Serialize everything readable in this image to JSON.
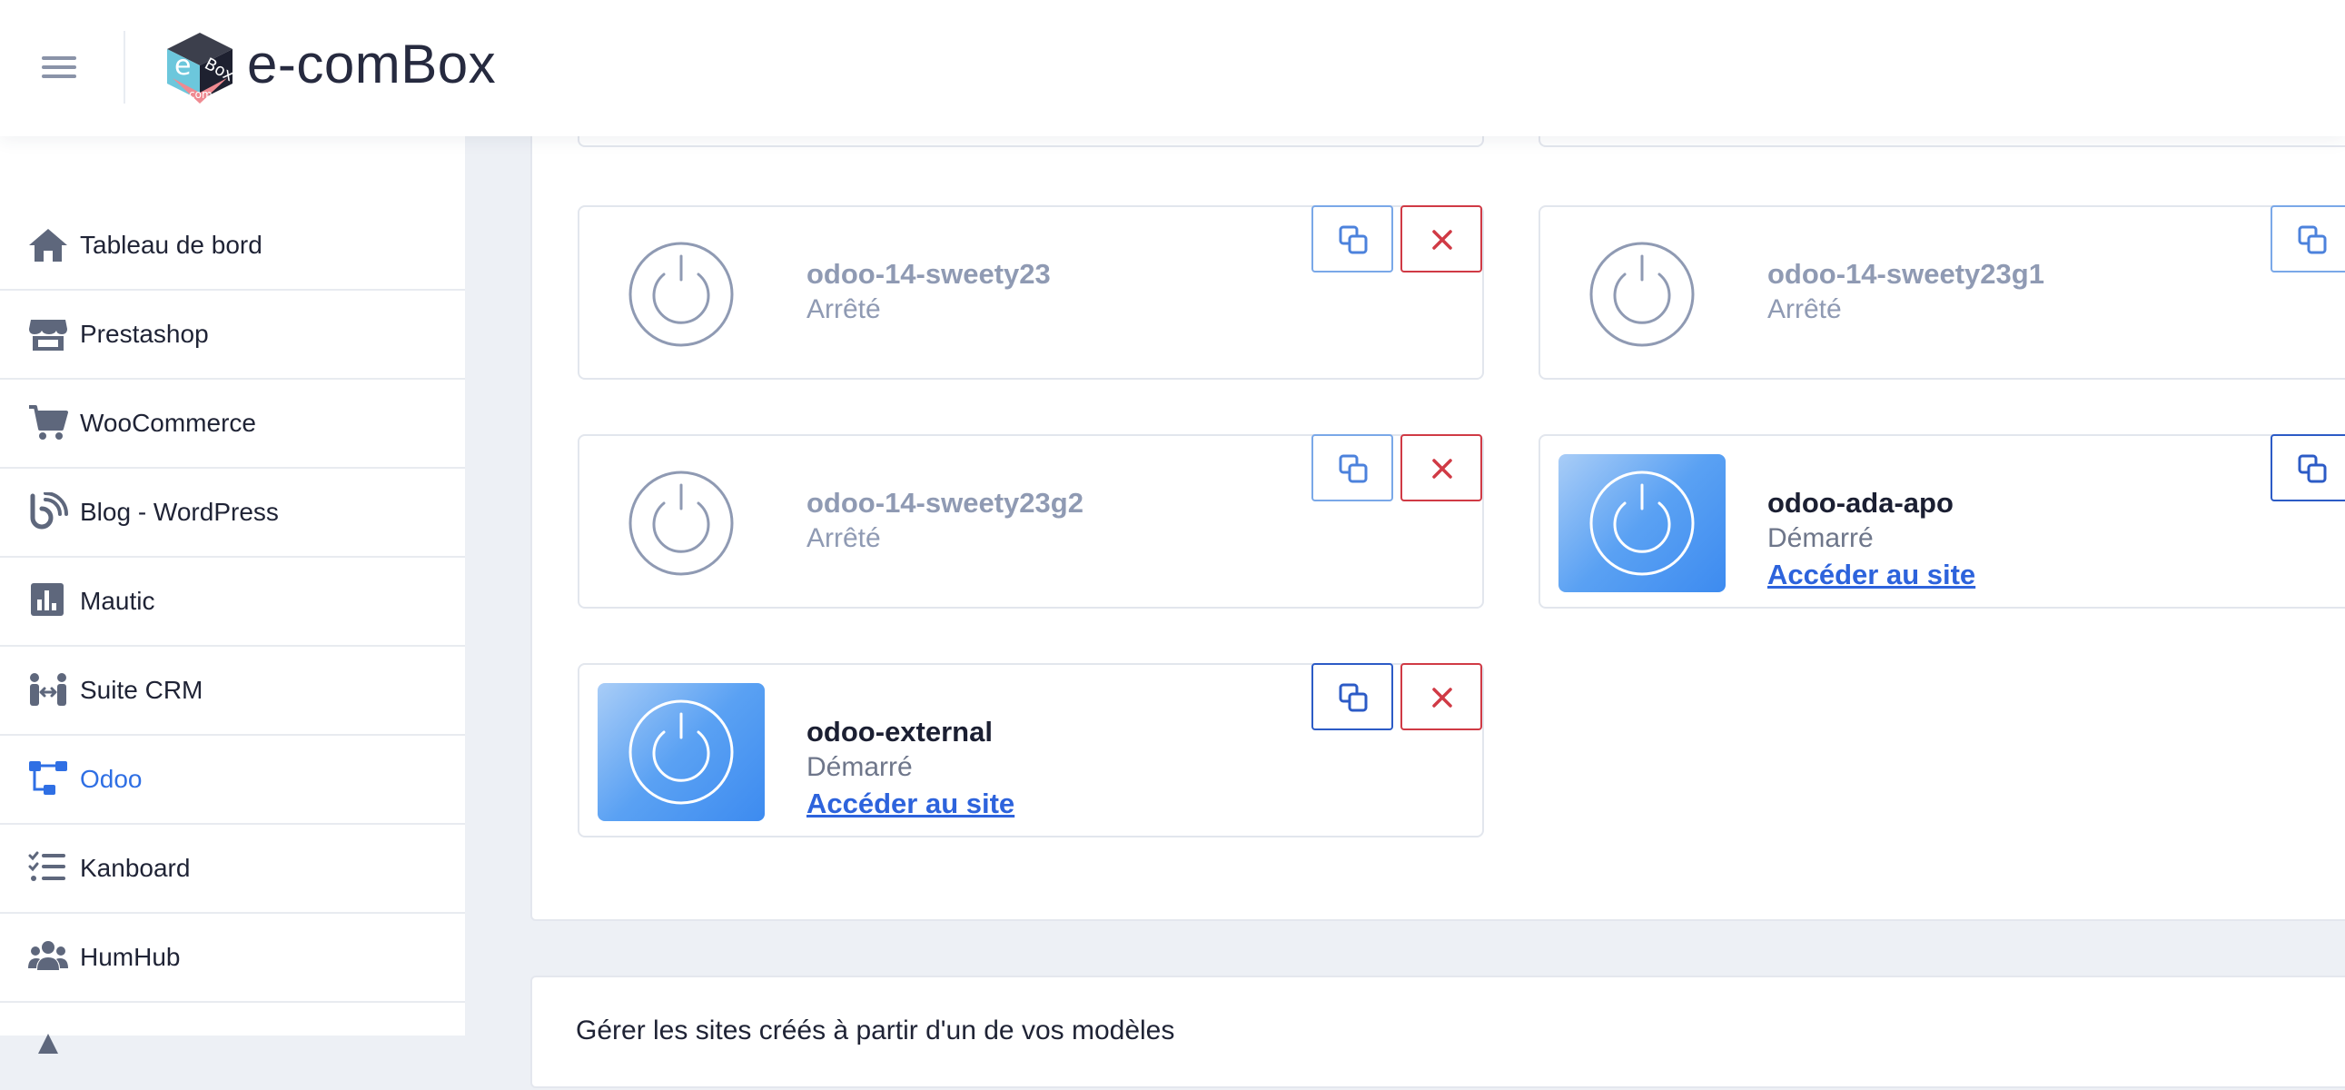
{
  "header": {
    "app_title": "e-comBox",
    "logo_text_top": "Box",
    "logo_text_letter": "e",
    "logo_text_bottom": "com"
  },
  "sidebar": {
    "items": [
      {
        "label": "Tableau de bord",
        "icon": "home-icon"
      },
      {
        "label": "Prestashop",
        "icon": "store-icon"
      },
      {
        "label": "WooCommerce",
        "icon": "cart-icon"
      },
      {
        "label": "Blog - WordPress",
        "icon": "blog-icon"
      },
      {
        "label": "Mautic",
        "icon": "chart-icon"
      },
      {
        "label": "Suite CRM",
        "icon": "crm-icon"
      },
      {
        "label": "Odoo",
        "icon": "odoo-icon",
        "active": true
      },
      {
        "label": "Kanboard",
        "icon": "tasks-icon"
      },
      {
        "label": "HumHub",
        "icon": "users-icon"
      }
    ]
  },
  "sites": [
    {
      "name": "odoo-14-sweety23",
      "status": "Arrêté",
      "running": false
    },
    {
      "name": "odoo-14-sweety23g1",
      "status": "Arrêté",
      "running": false
    },
    {
      "name": "odoo-14-sweety23g2",
      "status": "Arrêté",
      "running": false
    },
    {
      "name": "odoo-ada-apo",
      "status": "Démarré",
      "running": true,
      "link": "Accéder au site"
    },
    {
      "name": "odoo-external",
      "status": "Démarré",
      "running": true,
      "link": "Accéder au site"
    }
  ],
  "lower_section": {
    "title": "Gérer les sites créés à partir d'un de vos modèles"
  },
  "colors": {
    "accent": "#2f6fe4",
    "danger": "#d03a45",
    "running_gradient_end": "#3d8bf0",
    "stopped_gray": "#8f9ab3"
  }
}
